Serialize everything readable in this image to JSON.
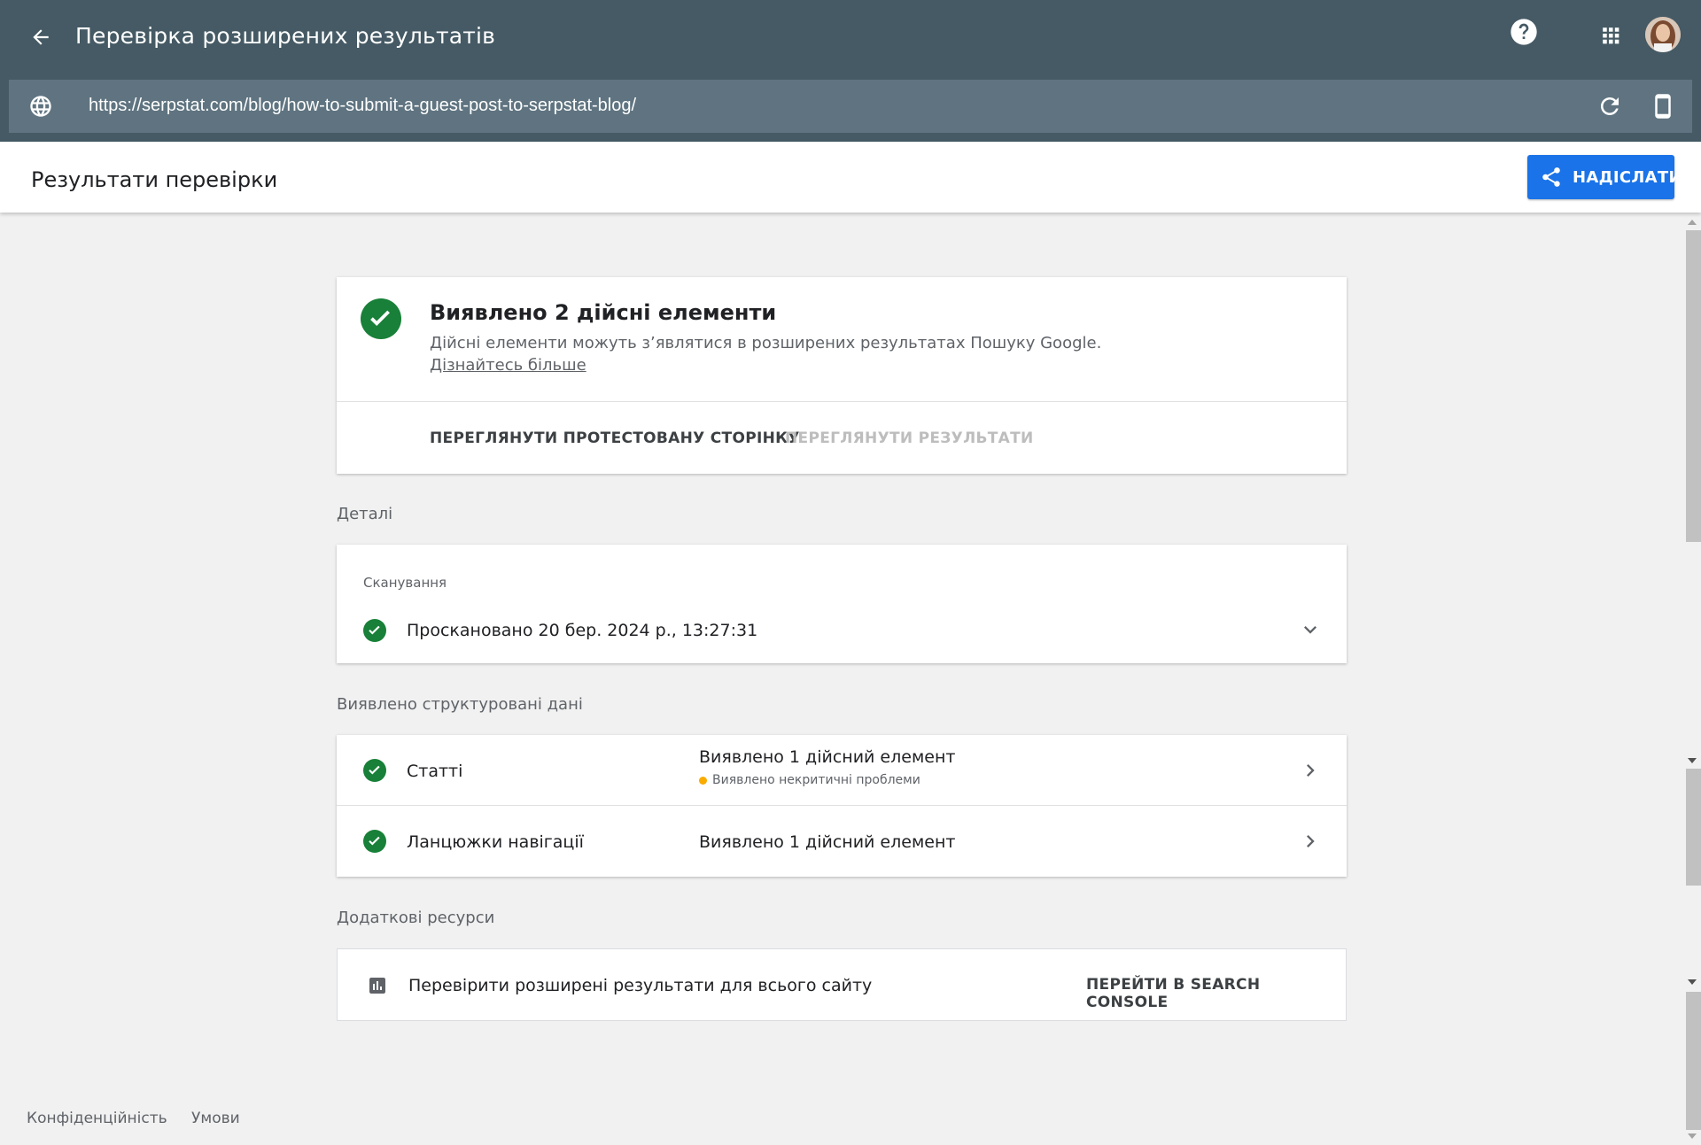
{
  "appbar": {
    "title": "Перевірка розширених результатів",
    "back_icon": "arrow-back-icon",
    "help_icon": "help-icon",
    "apps_icon": "apps-grid-icon",
    "avatar": "user-avatar"
  },
  "urlbar": {
    "url": "https://serpstat.com/blog/how-to-submit-a-guest-post-to-serpstat-blog/",
    "globe_icon": "globe-icon",
    "refresh_icon": "refresh-icon",
    "device_icon": "smartphone-icon"
  },
  "subheader": {
    "title": "Результати перевірки",
    "submit_label": "НАДІСЛАТИ",
    "submit_icon": "share-icon"
  },
  "result": {
    "title": "Виявлено 2 дійсні елементи",
    "description": "Дійсні елементи можуть з’являтися в розширених результатах Пошуку Google.",
    "learn_more": "Дізнайтесь більше",
    "view_page_label": "ПЕРЕГЛЯНУТИ ПРОТЕСТОВАНУ СТОРІНКУ",
    "view_results_label": "ПЕРЕГЛЯНУТИ РЕЗУЛЬТАТИ"
  },
  "details": {
    "section_label": "Деталі",
    "crawl_label": "Сканування",
    "crawl_status": "Проскановано 20 бер. 2024 р., 13:27:31"
  },
  "structured": {
    "section_label": "Виявлено структуровані дані",
    "rows": [
      {
        "name": "Статті",
        "status": "Виявлено 1 дійсний елемент",
        "warning": "Виявлено некритичні проблеми"
      },
      {
        "name": "Ланцюжки навігації",
        "status": "Виявлено 1 дійсний елемент",
        "warning": ""
      }
    ]
  },
  "resources": {
    "section_label": "Додаткові ресурси",
    "text": "Перевірити розширені результати для всього сайту",
    "button": "ПЕРЕЙТИ В SEARCH CONSOLE",
    "icon": "bar-chart-icon"
  },
  "footer": {
    "privacy": "Конфіденційність",
    "terms": "Умови"
  },
  "colors": {
    "appbar": "#455a64",
    "urlbar": "#5f7480",
    "accent": "#1a73e8",
    "success": "#188038",
    "warning": "#f9ab00"
  }
}
